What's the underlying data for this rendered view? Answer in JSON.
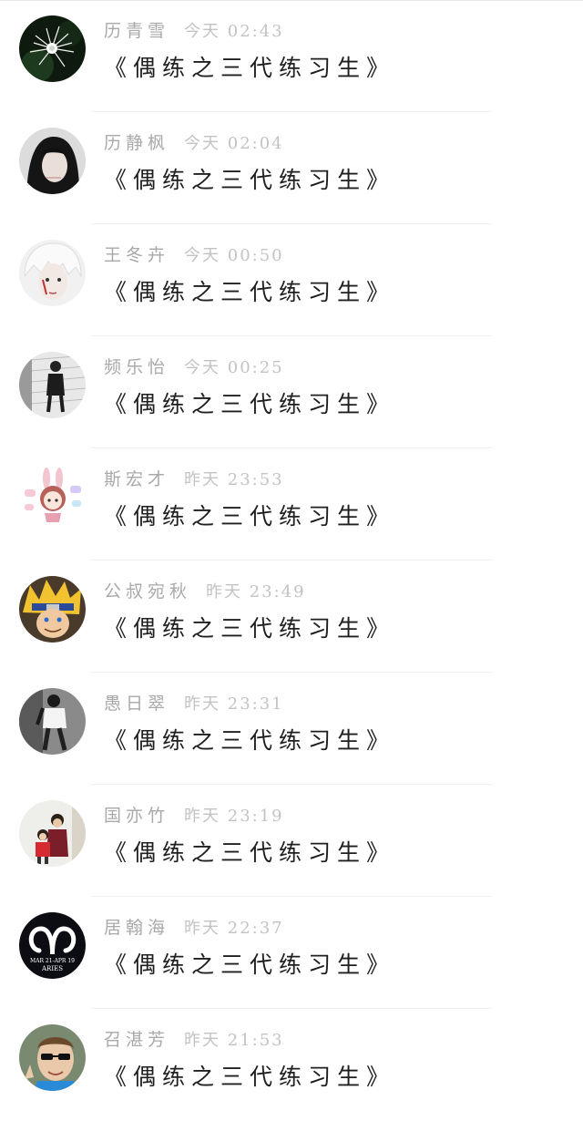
{
  "messages": [
    {
      "name": "历青雪",
      "time": "今天 02:43",
      "text": "《偶练之三代练习生》",
      "avatar": "spider-lily-flower"
    },
    {
      "name": "历静枫",
      "time": "今天 02:04",
      "text": "《偶练之三代练习生》",
      "avatar": "girl-with-dark-hair"
    },
    {
      "name": "王冬卉",
      "time": "今天 00:50",
      "text": "《偶练之三代练习生》",
      "avatar": "white-haired-person"
    },
    {
      "name": "频乐怡",
      "time": "今天 00:25",
      "text": "《偶练之三代练习生》",
      "avatar": "person-standing-grayscale"
    },
    {
      "name": "斯宏才",
      "time": "昨天 23:53",
      "text": "《偶练之三代练习生》",
      "avatar": "cartoon-bunny-stickers"
    },
    {
      "name": "公叔宛秋",
      "time": "昨天 23:49",
      "text": "《偶练之三代练习生》",
      "avatar": "naruto-anime-character"
    },
    {
      "name": "愚日翠",
      "time": "昨天 23:31",
      "text": "《偶练之三代练习生》",
      "avatar": "person-walking-grayscale"
    },
    {
      "name": "国亦竹",
      "time": "昨天 23:19",
      "text": "《偶练之三代练习生》",
      "avatar": "two-children-photo"
    },
    {
      "name": "居翰海",
      "time": "昨天 22:37",
      "text": "《偶练之三代练习生》",
      "avatar": "aries-zodiac-badge",
      "avatar_text_1": "MAR 21-APR 19",
      "avatar_text_2": "ARIES"
    },
    {
      "name": "召湛芳",
      "time": "昨天 21:53",
      "text": "《偶练之三代练习生》",
      "avatar": "boy-with-sunglasses"
    }
  ],
  "colors": {
    "name": "#a9a9a9",
    "time": "#c3c3c3",
    "message": "#1f1f1f",
    "separator": "#f0f0f0"
  }
}
